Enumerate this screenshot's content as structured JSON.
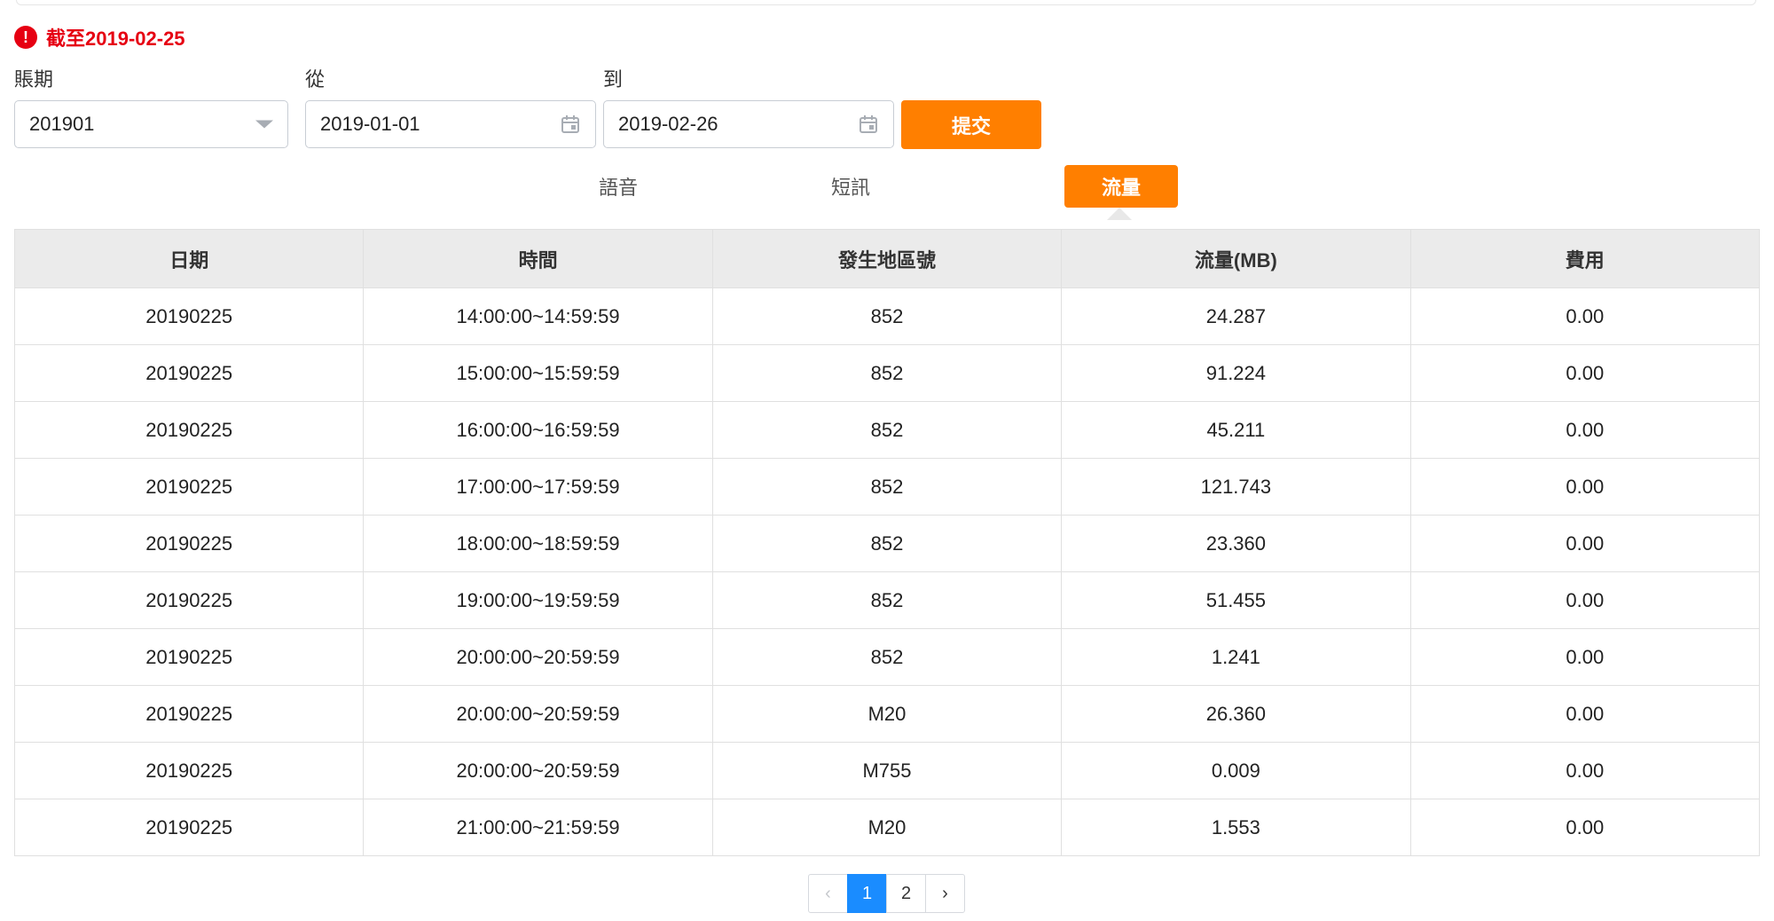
{
  "notice": {
    "text": "截至2019-02-25",
    "icon": "exclamation-icon"
  },
  "filters": {
    "period_label": "賬期",
    "period_value": "201901",
    "from_label": "從",
    "from_value": "2019-01-01",
    "to_label": "到",
    "to_value": "2019-02-26",
    "submit_label": "提交"
  },
  "tabs": [
    {
      "label": "語音",
      "active": false
    },
    {
      "label": "短訊",
      "active": false
    },
    {
      "label": "流量",
      "active": true
    }
  ],
  "table": {
    "headers": [
      "日期",
      "時間",
      "發生地區號",
      "流量(MB)",
      "費用"
    ],
    "rows": [
      [
        "20190225",
        "14:00:00~14:59:59",
        "852",
        "24.287",
        "0.00"
      ],
      [
        "20190225",
        "15:00:00~15:59:59",
        "852",
        "91.224",
        "0.00"
      ],
      [
        "20190225",
        "16:00:00~16:59:59",
        "852",
        "45.211",
        "0.00"
      ],
      [
        "20190225",
        "17:00:00~17:59:59",
        "852",
        "121.743",
        "0.00"
      ],
      [
        "20190225",
        "18:00:00~18:59:59",
        "852",
        "23.360",
        "0.00"
      ],
      [
        "20190225",
        "19:00:00~19:59:59",
        "852",
        "51.455",
        "0.00"
      ],
      [
        "20190225",
        "20:00:00~20:59:59",
        "852",
        "1.241",
        "0.00"
      ],
      [
        "20190225",
        "20:00:00~20:59:59",
        "M20",
        "26.360",
        "0.00"
      ],
      [
        "20190225",
        "20:00:00~20:59:59",
        "M755",
        "0.009",
        "0.00"
      ],
      [
        "20190225",
        "21:00:00~21:59:59",
        "M20",
        "1.553",
        "0.00"
      ]
    ]
  },
  "pagination": {
    "prev": "‹",
    "pages": [
      "1",
      "2"
    ],
    "current": "1",
    "next": "›"
  },
  "colors": {
    "accent": "#ff7f00",
    "alert": "#e60012",
    "page_active": "#1a8cff",
    "header_bg": "#ebebeb"
  }
}
